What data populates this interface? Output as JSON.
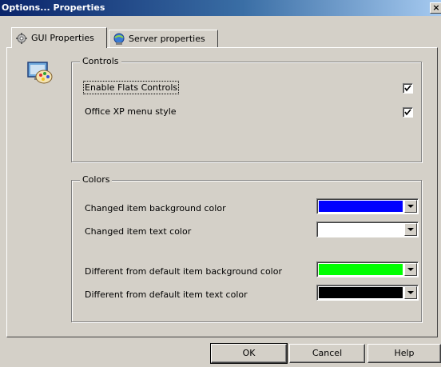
{
  "window": {
    "title": "Options... Properties",
    "close_glyph": "×"
  },
  "tabs": [
    {
      "label": "GUI Properties",
      "icon": "gear-icon",
      "active": true
    },
    {
      "label": "Server properties",
      "icon": "server-icon",
      "active": false
    }
  ],
  "controls": {
    "heading": "Controls",
    "items": [
      {
        "label": "Enable Flats Controls",
        "checked": true
      },
      {
        "label": "Office XP menu style",
        "checked": true
      }
    ]
  },
  "colors": {
    "heading": "Colors",
    "items": [
      {
        "label": "Changed item background color",
        "color": "#0000ff"
      },
      {
        "label": "Changed item text color",
        "color": "#ffffff"
      },
      {
        "label": "Different from default  item background color",
        "color": "#00ff00"
      },
      {
        "label": "Different from default  item text color",
        "color": "#000000"
      }
    ]
  },
  "buttons": {
    "ok": "OK",
    "cancel": "Cancel",
    "help": "Help"
  },
  "theme": {
    "titlebar_start": "#0a246a",
    "face": "#d4d0c8"
  }
}
